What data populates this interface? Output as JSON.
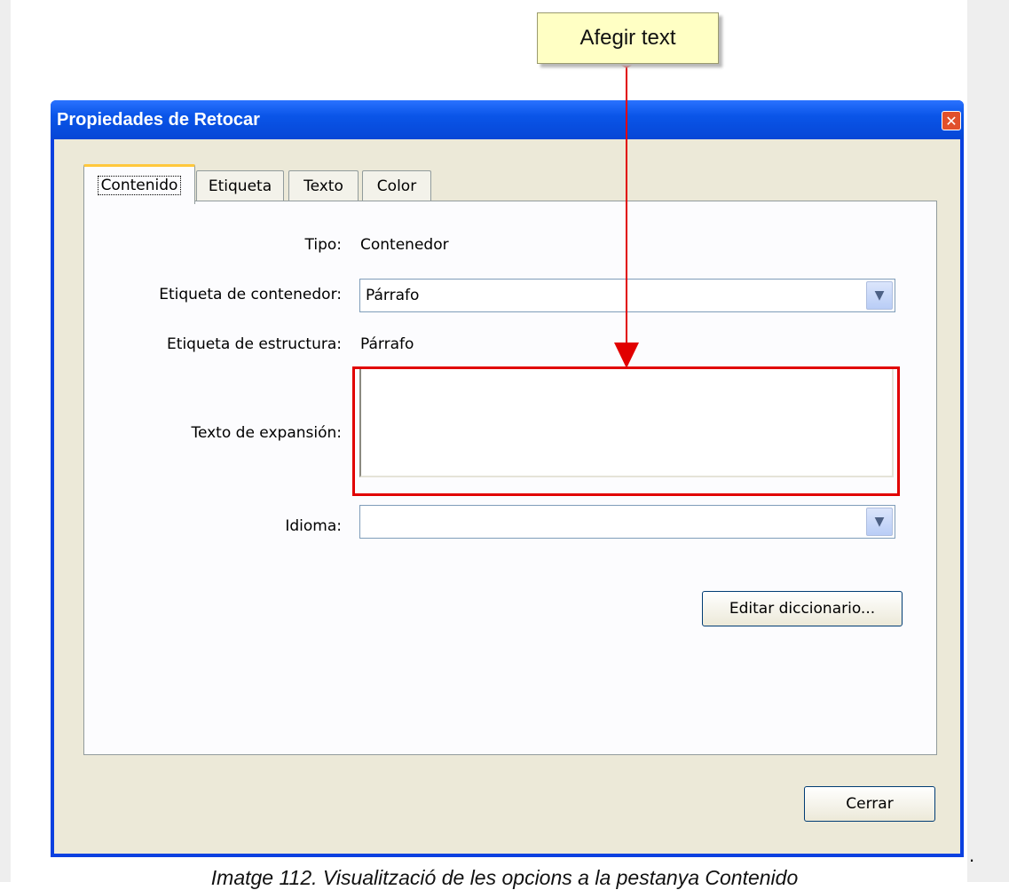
{
  "callout": {
    "text": "Afegir text"
  },
  "dialog": {
    "title": "Propiedades de Retocar",
    "close_glyph": "✕",
    "tabs": [
      "Contenido",
      "Etiqueta",
      "Texto",
      "Color"
    ],
    "active_tab": "Contenido",
    "fields": {
      "tipo_label": "Tipo:",
      "tipo_value": "Contenedor",
      "container_tag_label": "Etiqueta de contenedor:",
      "container_tag_value": "Párrafo",
      "structure_tag_label": "Etiqueta de estructura:",
      "structure_tag_value": "Párrafo",
      "expansion_label": "Texto de expansión:",
      "expansion_value": "",
      "language_label": "Idioma:",
      "language_value": ""
    },
    "edit_dictionary_button": "Editar diccionario...",
    "close_button": "Cerrar"
  },
  "annotation_colors": {
    "arrow": "#e10000",
    "highlight": "#e10000",
    "callout_bg": "#ffffc4"
  },
  "caption": "Imatge 112. Visualització de les opcions a la pestanya Contenido",
  "trailing_mark": "."
}
